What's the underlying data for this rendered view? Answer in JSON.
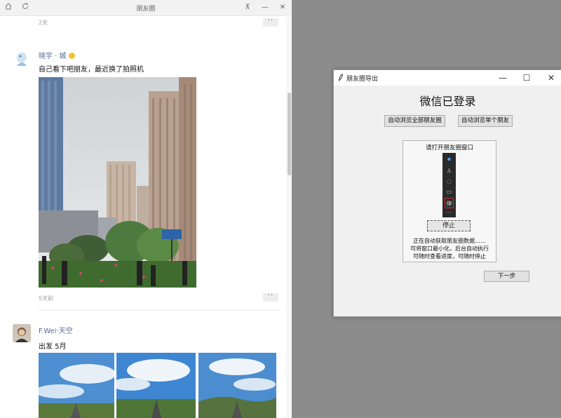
{
  "moments_window": {
    "title": "朋友圈",
    "controls": {
      "home_icon": "home-icon",
      "refresh_icon": "refresh-icon",
      "pin": "⊼",
      "minimize": "—",
      "close": "✕"
    },
    "top_partial_time": "2天",
    "posts": [
      {
        "user": "晓宇 · 城",
        "text": "自己看下吧朋友，最近换了拍照机",
        "time": "5天前",
        "image_alt": "city buildings photo"
      },
      {
        "user": "F.Wei·天空",
        "text": "出发 5月",
        "time": "",
        "image_alt": "sky road photos"
      }
    ]
  },
  "dialog": {
    "title": "朋友圈导出",
    "controls": {
      "minimize": "—",
      "maximize": "☐",
      "close": "✕"
    },
    "heading": "微信已登录",
    "btn_browse_all": "自动浏览全部朋友圈",
    "btn_browse_single": "自动浏览单个朋友",
    "guide_title": "请打开朋友圈窗口",
    "mini_icons": [
      "chat-icon",
      "contacts-icon",
      "favorites-icon",
      "folder-icon",
      "moments-icon"
    ],
    "mini_highlight_label": "停",
    "stop_label": "停止",
    "notes": [
      "正在自动获取朋友圈数据……",
      "可将窗口最小化，后台自动执行",
      "可随时查看进度，可随时停止"
    ],
    "next_label": "下一步"
  },
  "colors": {
    "accent_link": "#5b6b96",
    "highlight_red": "#d93025"
  }
}
